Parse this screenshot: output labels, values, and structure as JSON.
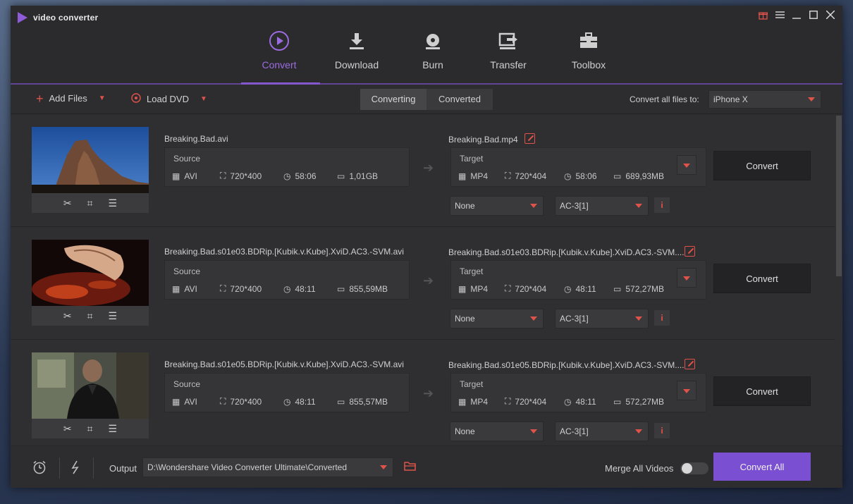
{
  "app": {
    "title": "video converter"
  },
  "window_controls": [
    "gift-icon",
    "menu-icon",
    "minimize-icon",
    "maximize-icon",
    "close-icon"
  ],
  "nav": [
    {
      "id": "convert",
      "label": "Convert",
      "active": true
    },
    {
      "id": "download",
      "label": "Download"
    },
    {
      "id": "burn",
      "label": "Burn"
    },
    {
      "id": "transfer",
      "label": "Transfer"
    },
    {
      "id": "toolbox",
      "label": "Toolbox"
    }
  ],
  "toolbar": {
    "add_files": "Add Files",
    "load_dvd": "Load DVD",
    "tabs": [
      "Converting",
      "Converted"
    ],
    "convert_all_to_label": "Convert all files to:",
    "convert_all_to_value": "iPhone X"
  },
  "files": [
    {
      "name": "Breaking.Bad.avi",
      "source": {
        "title": "Source",
        "format": "AVI",
        "resolution": "720*400",
        "duration": "58:06",
        "size": "1,01GB"
      },
      "target_name": "Breaking.Bad.mp4",
      "target": {
        "title": "Target",
        "format": "MP4",
        "resolution": "720*404",
        "duration": "58:06",
        "size": "689,93MB"
      },
      "subtitle": "None",
      "audio": "AC-3[1]",
      "convert": "Convert"
    },
    {
      "name": "Breaking.Bad.s01e03.BDRip.[Kubik.v.Kube].XviD.AC3.-SVM.avi",
      "source": {
        "title": "Source",
        "format": "AVI",
        "resolution": "720*400",
        "duration": "48:11",
        "size": "855,59MB"
      },
      "target_name": "Breaking.Bad.s01e03.BDRip.[Kubik.v.Kube].XviD.AC3.-SVM....",
      "target": {
        "title": "Target",
        "format": "MP4",
        "resolution": "720*404",
        "duration": "48:11",
        "size": "572,27MB"
      },
      "subtitle": "None",
      "audio": "AC-3[1]",
      "convert": "Convert"
    },
    {
      "name": "Breaking.Bad.s01e05.BDRip.[Kubik.v.Kube].XviD.AC3.-SVM.avi",
      "source": {
        "title": "Source",
        "format": "AVI",
        "resolution": "720*400",
        "duration": "48:11",
        "size": "855,57MB"
      },
      "target_name": "Breaking.Bad.s01e05.BDRip.[Kubik.v.Kube].XviD.AC3.-SVM....",
      "target": {
        "title": "Target",
        "format": "MP4",
        "resolution": "720*404",
        "duration": "48:11",
        "size": "572,27MB"
      },
      "subtitle": "None",
      "audio": "AC-3[1]",
      "convert": "Convert"
    }
  ],
  "bottom": {
    "output_label": "Output",
    "output_path": "D:\\Wondershare Video Converter Ultimate\\Converted",
    "merge_label": "Merge All Videos",
    "merge_enabled": false,
    "convert_all": "Convert All"
  },
  "colors": {
    "accent": "#8e5cd9",
    "danger": "#e0534a",
    "background": "#2f2f31"
  }
}
